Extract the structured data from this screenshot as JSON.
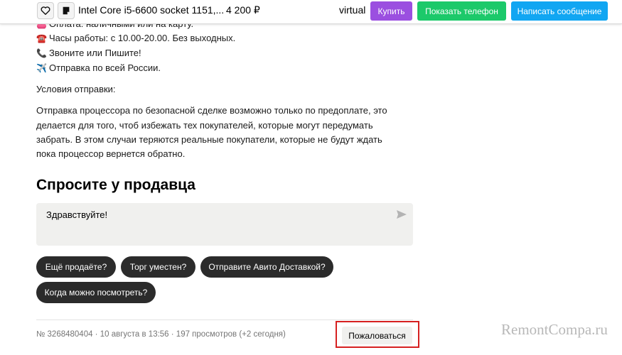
{
  "header": {
    "title": "Intel Core i5-6600 socket 1151,...",
    "price": "4 200 ₽",
    "seller": "virtual",
    "buy_label": "Купить",
    "phone_label": "Показать телефон",
    "message_label": "Написать сообщение"
  },
  "description": {
    "lines": [
      {
        "emoji": "👛",
        "text": "Оплата: наличными или на карту."
      },
      {
        "emoji": "☎️",
        "text": "Часы работы: с 10.00-20.00. Без выходных."
      },
      {
        "emoji": "📞",
        "text": "Звоните или Пишите!"
      },
      {
        "emoji": "✈️",
        "text": "Отправка по всей России."
      }
    ],
    "shipping_heading": "Условия отправки:",
    "shipping_text": [
      "Отправка процессора по безопасной сделке возможно только по предоплате, это",
      "делается для того, чтоб избежать тех покупателей, которые могут передумать",
      "забрать. В этом случаи теряются реальные покупатели, которые не будут ждать",
      "пока процессор вернется обратно."
    ]
  },
  "ask_seller": {
    "title": "Спросите у продавца",
    "message": "Здравствуйте!",
    "chips": [
      "Ещё продаёте?",
      "Торг уместен?",
      "Отправите Авито Доставкой?",
      "Когда можно посмотреть?"
    ]
  },
  "footer": {
    "meta": "№ 3268480404 · 10 августа в 13:56 · 197 просмотров (+2 сегодня)",
    "report_label": "Пожаловаться"
  },
  "watermark": "RemontCompa.ru",
  "colors": {
    "buy": "#9b4fe0",
    "phone": "#1cc96a",
    "message": "#11a6f2",
    "highlight": "#d62020"
  }
}
